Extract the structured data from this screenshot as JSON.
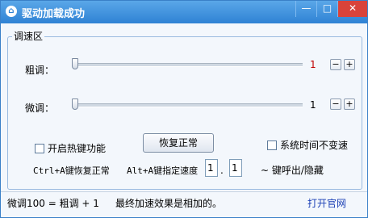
{
  "window": {
    "title": "驱动加载成功",
    "min_glyph": "—",
    "max_glyph": "□",
    "close_glyph": "✕"
  },
  "group": {
    "title": "调速区"
  },
  "coarse": {
    "label": "粗调：",
    "value": "1",
    "minus": "−",
    "plus": "+",
    "level_fraction": 0
  },
  "fine": {
    "label": "微调：",
    "value": "1",
    "minus": "−",
    "plus": "+",
    "level_fraction": 0
  },
  "hotkey_checkbox": {
    "label": "开启热键功能",
    "checked": false
  },
  "restore_button": {
    "label": "恢复正常"
  },
  "time_checkbox": {
    "label": "系统时间不变速",
    "checked": false
  },
  "hotkeys": {
    "restore_hint": "Ctrl+A键恢复正常",
    "speed_hint": "Alt+A键指定速度",
    "speed_int": "1",
    "speed_sep": ".",
    "speed_frac": "1",
    "toggle_hint": "~ 键呼出/隐藏"
  },
  "status": {
    "formula": "微调100 = 粗调 + 1",
    "note": "最终加速效果是相加的。",
    "link": "打开官网"
  },
  "colors": {
    "title_bar": "#2f82d4",
    "coarse_value": "#c00000",
    "link": "#1a3fb5"
  }
}
